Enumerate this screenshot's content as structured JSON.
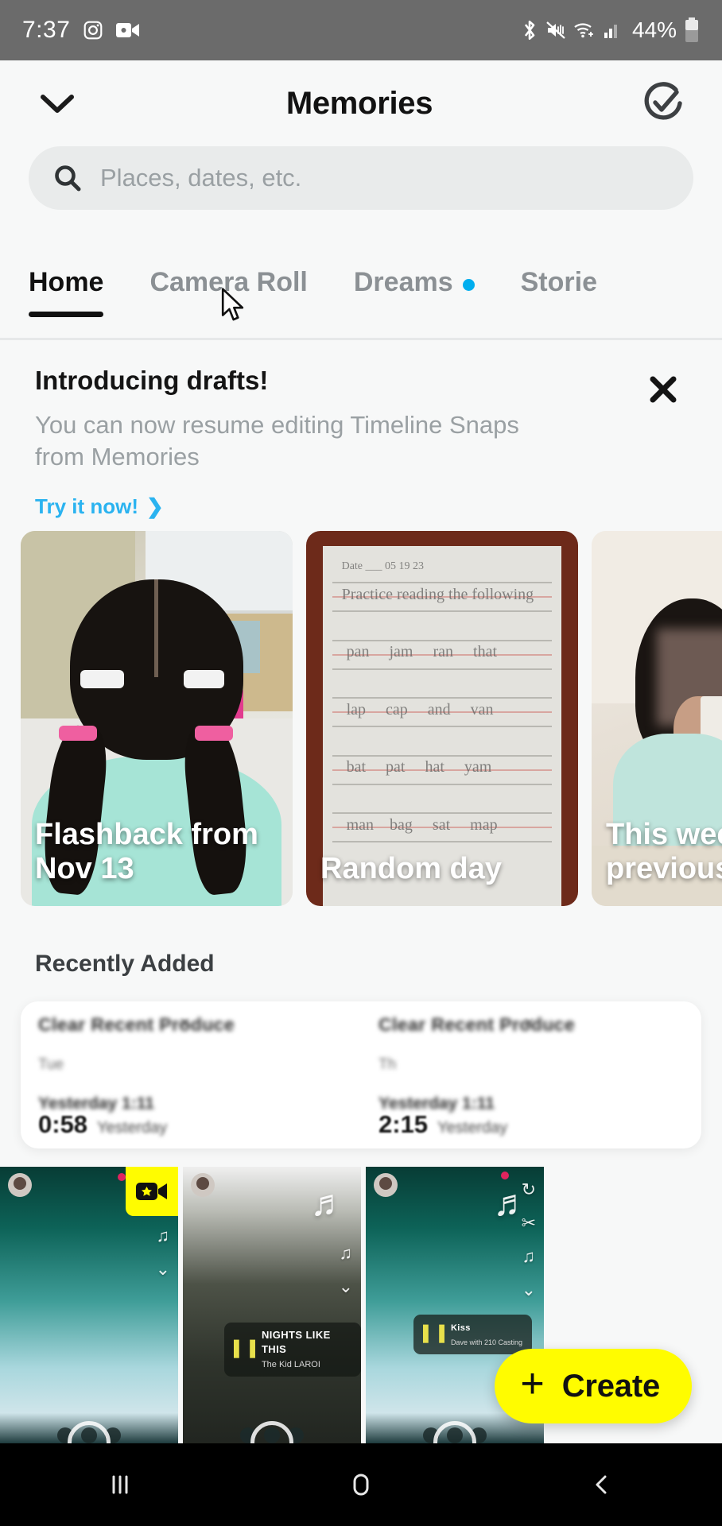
{
  "status_bar": {
    "time": "7:37",
    "left_icons": [
      "instagram-icon",
      "video-camera-icon"
    ],
    "right_icons": [
      "bluetooth-icon",
      "mute-vibrate-icon",
      "wifi-icon",
      "cellular-signal-icon"
    ],
    "battery_text": "44%",
    "battery_icon": "battery-icon",
    "background_color": "#6b6b6b"
  },
  "header": {
    "title": "Memories",
    "collapse_icon": "chevron-down-icon",
    "select_icon": "circle-check-icon"
  },
  "search": {
    "placeholder": "Places, dates, etc.",
    "value": "",
    "icon": "search-icon"
  },
  "tabs": {
    "items": [
      {
        "label": "Home",
        "active": true,
        "dot": false
      },
      {
        "label": "Camera Roll",
        "active": false,
        "dot": false
      },
      {
        "label": "Dreams",
        "active": false,
        "dot": true
      },
      {
        "label": "Storie",
        "active": false,
        "dot": false
      }
    ],
    "dot_color": "#00aeef"
  },
  "banner": {
    "title": "Introducing drafts!",
    "subtitle": "You can now resume editing Timeline Snaps from Memories",
    "cta": "Try it now!",
    "cta_chevron": "❯",
    "cta_color": "#2bb3f0",
    "close_icon": "close-icon"
  },
  "memories": {
    "cards": [
      {
        "label": "Flashback from Nov 13",
        "name": "memory-card-flashback"
      },
      {
        "label": "Random day",
        "name": "memory-card-random-day"
      },
      {
        "label": "This wee previous",
        "name": "memory-card-this-week"
      }
    ]
  },
  "recently_added": {
    "section_title": "Recently Added",
    "loading_card": {
      "columns": [
        {
          "title": "Clear Recent Produce",
          "sub": "Tue",
          "mid": "Yesterday 1:11",
          "duration": "0:58",
          "trailing": "Yesterday",
          "close": "×"
        },
        {
          "title": "Clear Recent Produce",
          "sub": "Th",
          "mid": "Yesterday 1:11",
          "duration": "2:15",
          "trailing": "Yesterday",
          "close": "×"
        }
      ]
    }
  },
  "snaps": [
    {
      "name": "snap-thumb-1",
      "badge_icon": "video-camera-badge-icon",
      "badge_color": "#fffc00",
      "rail_icons": [
        "music-note-icon",
        "chevron-down-icon"
      ],
      "has_notification_dot": true,
      "music": null
    },
    {
      "name": "snap-thumb-2",
      "badge_icon": null,
      "rail_icons": [
        "music-note-icon",
        "chevron-down-icon"
      ],
      "has_notification_dot": false,
      "music": {
        "title": "NIGHTS LIKE THIS",
        "artist": "The Kid LAROI",
        "icon": "equalizer-icon"
      }
    },
    {
      "name": "snap-thumb-3",
      "badge_icon": null,
      "rail_icons": [
        "music-note-icon",
        "loop-icon",
        "chevron-down-icon"
      ],
      "has_notification_dot": true,
      "music": {
        "title": "Kiss",
        "artist": "Dave with 210 Casting",
        "icon": "equalizer-icon"
      }
    }
  ],
  "fab": {
    "label": "Create",
    "plus": "+",
    "color": "#fffc00"
  },
  "navbar": {
    "recents_icon": "recents-icon",
    "home_icon": "home-icon",
    "back_icon": "back-icon"
  }
}
